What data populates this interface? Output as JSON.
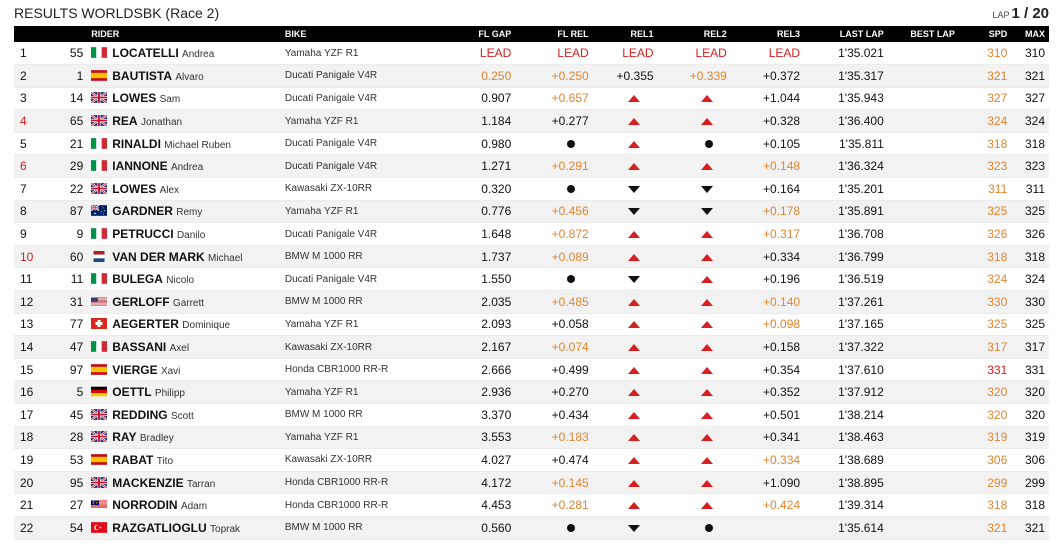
{
  "header": {
    "title": "RESULTS WORLDSBK (Race 2)",
    "lap_label": "LAP",
    "lap_value": "1 / 20"
  },
  "columns": [
    "RIDER",
    "BIKE",
    "FL GAP",
    "FL REL",
    "REL1",
    "REL2",
    "REL3",
    "LAST LAP",
    "BEST LAP",
    "SPD",
    "MAX"
  ],
  "colors": {
    "red": "#d42020",
    "orange": "#e0852e",
    "header_bg": "#000000"
  },
  "rows": [
    {
      "pos": "1",
      "num": "55",
      "flag": "italy-flag",
      "surname": "LOCATELLI",
      "given": "Andrea",
      "bike": "Yamaha YZF R1",
      "fl_gap": "LEAD",
      "fl_gap_c": "lead",
      "fl_rel": "LEAD",
      "fl_rel_c": "lead",
      "rel1": "LEAD",
      "rel1_c": "lead",
      "rel2": "LEAD",
      "rel2_c": "lead",
      "rel3": "LEAD",
      "rel3_c": "lead",
      "last_lap": "1'35.021",
      "best_lap": "",
      "spd": "310",
      "spd_c": "orange",
      "max": "310",
      "pos_red": false
    },
    {
      "pos": "2",
      "num": "1",
      "flag": "spain-flag",
      "surname": "BAUTISTA",
      "given": "Alvaro",
      "bike": "Ducati Panigale V4R",
      "fl_gap": "0.250",
      "fl_gap_c": "orange",
      "fl_rel": "+0.250",
      "fl_rel_c": "orange",
      "rel1": "+0.355",
      "rel1_c": "",
      "rel2": "+0.339",
      "rel2_c": "orange",
      "rel3": "+0.372",
      "rel3_c": "",
      "last_lap": "1'35.317",
      "best_lap": "",
      "spd": "321",
      "spd_c": "orange",
      "max": "321",
      "pos_red": false
    },
    {
      "pos": "3",
      "num": "14",
      "flag": "uk-flag",
      "surname": "LOWES",
      "given": "Sam",
      "bike": "Ducati Panigale V4R",
      "fl_gap": "0.907",
      "fl_gap_c": "",
      "fl_rel": "+0.657",
      "fl_rel_c": "orange",
      "rel1": "up",
      "rel1_c": "",
      "rel2": "up",
      "rel2_c": "",
      "rel3": "+1.044",
      "rel3_c": "",
      "last_lap": "1'35.943",
      "best_lap": "",
      "spd": "327",
      "spd_c": "orange",
      "max": "327",
      "pos_red": false
    },
    {
      "pos": "4",
      "num": "65",
      "flag": "uk-flag",
      "surname": "REA",
      "given": "Jonathan",
      "bike": "Yamaha YZF R1",
      "fl_gap": "1.184",
      "fl_gap_c": "",
      "fl_rel": "+0.277",
      "fl_rel_c": "",
      "rel1": "up",
      "rel1_c": "",
      "rel2": "up",
      "rel2_c": "",
      "rel3": "+0.328",
      "rel3_c": "",
      "last_lap": "1'36.400",
      "best_lap": "",
      "spd": "324",
      "spd_c": "orange",
      "max": "324",
      "pos_red": true
    },
    {
      "pos": "5",
      "num": "21",
      "flag": "italy-flag",
      "surname": "RINALDI",
      "given": "Michael Ruben",
      "bike": "Ducati Panigale V4R",
      "fl_gap": "0.980",
      "fl_gap_c": "",
      "fl_rel": "dot",
      "fl_rel_c": "",
      "rel1": "up",
      "rel1_c": "",
      "rel2": "dot",
      "rel2_c": "",
      "rel3": "+0.105",
      "rel3_c": "",
      "last_lap": "1'35.811",
      "best_lap": "",
      "spd": "318",
      "spd_c": "orange",
      "max": "318",
      "pos_red": false
    },
    {
      "pos": "6",
      "num": "29",
      "flag": "italy-flag",
      "surname": "IANNONE",
      "given": "Andrea",
      "bike": "Ducati Panigale V4R",
      "fl_gap": "1.271",
      "fl_gap_c": "",
      "fl_rel": "+0.291",
      "fl_rel_c": "orange",
      "rel1": "up",
      "rel1_c": "",
      "rel2": "up",
      "rel2_c": "",
      "rel3": "+0.148",
      "rel3_c": "orange",
      "last_lap": "1'36.324",
      "best_lap": "",
      "spd": "323",
      "spd_c": "orange",
      "max": "323",
      "pos_red": true
    },
    {
      "pos": "7",
      "num": "22",
      "flag": "uk-flag",
      "surname": "LOWES",
      "given": "Alex",
      "bike": "Kawasaki ZX-10RR",
      "fl_gap": "0.320",
      "fl_gap_c": "",
      "fl_rel": "dot",
      "fl_rel_c": "",
      "rel1": "down",
      "rel1_c": "",
      "rel2": "down",
      "rel2_c": "",
      "rel3": "+0.164",
      "rel3_c": "",
      "last_lap": "1'35.201",
      "best_lap": "",
      "spd": "311",
      "spd_c": "orange",
      "max": "311",
      "pos_red": false
    },
    {
      "pos": "8",
      "num": "87",
      "flag": "australia-flag",
      "surname": "GARDNER",
      "given": "Remy",
      "bike": "Yamaha YZF R1",
      "fl_gap": "0.776",
      "fl_gap_c": "",
      "fl_rel": "+0.456",
      "fl_rel_c": "orange",
      "rel1": "down",
      "rel1_c": "",
      "rel2": "down",
      "rel2_c": "",
      "rel3": "+0.178",
      "rel3_c": "orange",
      "last_lap": "1'35.891",
      "best_lap": "",
      "spd": "325",
      "spd_c": "orange",
      "max": "325",
      "pos_red": false
    },
    {
      "pos": "9",
      "num": "9",
      "flag": "italy-flag",
      "surname": "PETRUCCI",
      "given": "Danilo",
      "bike": "Ducati Panigale V4R",
      "fl_gap": "1.648",
      "fl_gap_c": "",
      "fl_rel": "+0.872",
      "fl_rel_c": "orange",
      "rel1": "up",
      "rel1_c": "",
      "rel2": "up",
      "rel2_c": "",
      "rel3": "+0.317",
      "rel3_c": "orange",
      "last_lap": "1'36.708",
      "best_lap": "",
      "spd": "326",
      "spd_c": "orange",
      "max": "326",
      "pos_red": false
    },
    {
      "pos": "10",
      "num": "60",
      "flag": "netherlands-flag",
      "surname": "VAN DER MARK",
      "given": "Michael",
      "bike": "BMW M 1000 RR",
      "fl_gap": "1.737",
      "fl_gap_c": "",
      "fl_rel": "+0.089",
      "fl_rel_c": "orange",
      "rel1": "up",
      "rel1_c": "",
      "rel2": "up",
      "rel2_c": "",
      "rel3": "+0.334",
      "rel3_c": "",
      "last_lap": "1'36.799",
      "best_lap": "",
      "spd": "318",
      "spd_c": "orange",
      "max": "318",
      "pos_red": true
    },
    {
      "pos": "11",
      "num": "11",
      "flag": "italy-flag",
      "surname": "BULEGA",
      "given": "Nicolo",
      "bike": "Ducati Panigale V4R",
      "fl_gap": "1.550",
      "fl_gap_c": "",
      "fl_rel": "dot",
      "fl_rel_c": "",
      "rel1": "down",
      "rel1_c": "",
      "rel2": "up",
      "rel2_c": "",
      "rel3": "+0.196",
      "rel3_c": "",
      "last_lap": "1'36.519",
      "best_lap": "",
      "spd": "324",
      "spd_c": "orange",
      "max": "324",
      "pos_red": false
    },
    {
      "pos": "12",
      "num": "31",
      "flag": "usa-flag",
      "surname": "GERLOFF",
      "given": "Garrett",
      "bike": "BMW M 1000 RR",
      "fl_gap": "2.035",
      "fl_gap_c": "",
      "fl_rel": "+0.485",
      "fl_rel_c": "orange",
      "rel1": "up",
      "rel1_c": "",
      "rel2": "up",
      "rel2_c": "",
      "rel3": "+0.140",
      "rel3_c": "orange",
      "last_lap": "1'37.261",
      "best_lap": "",
      "spd": "330",
      "spd_c": "orange",
      "max": "330",
      "pos_red": false
    },
    {
      "pos": "13",
      "num": "77",
      "flag": "switzerland-flag",
      "surname": "AEGERTER",
      "given": "Dominique",
      "bike": "Yamaha YZF R1",
      "fl_gap": "2.093",
      "fl_gap_c": "",
      "fl_rel": "+0.058",
      "fl_rel_c": "",
      "rel1": "up",
      "rel1_c": "",
      "rel2": "up",
      "rel2_c": "",
      "rel3": "+0.098",
      "rel3_c": "orange",
      "last_lap": "1'37.165",
      "best_lap": "",
      "spd": "325",
      "spd_c": "orange",
      "max": "325",
      "pos_red": false
    },
    {
      "pos": "14",
      "num": "47",
      "flag": "italy-flag",
      "surname": "BASSANI",
      "given": "Axel",
      "bike": "Kawasaki ZX-10RR",
      "fl_gap": "2.167",
      "fl_gap_c": "",
      "fl_rel": "+0.074",
      "fl_rel_c": "orange",
      "rel1": "up",
      "rel1_c": "",
      "rel2": "up",
      "rel2_c": "",
      "rel3": "+0.158",
      "rel3_c": "",
      "last_lap": "1'37.322",
      "best_lap": "",
      "spd": "317",
      "spd_c": "orange",
      "max": "317",
      "pos_red": false
    },
    {
      "pos": "15",
      "num": "97",
      "flag": "spain-flag",
      "surname": "VIERGE",
      "given": "Xavi",
      "bike": "Honda CBR1000 RR-R",
      "fl_gap": "2.666",
      "fl_gap_c": "",
      "fl_rel": "+0.499",
      "fl_rel_c": "",
      "rel1": "up",
      "rel1_c": "",
      "rel2": "up",
      "rel2_c": "",
      "rel3": "+0.354",
      "rel3_c": "",
      "last_lap": "1'37.610",
      "best_lap": "",
      "spd": "331",
      "spd_c": "red",
      "max": "331",
      "pos_red": false
    },
    {
      "pos": "16",
      "num": "5",
      "flag": "germany-flag",
      "surname": "OETTL",
      "given": "Philipp",
      "bike": "Yamaha YZF R1",
      "fl_gap": "2.936",
      "fl_gap_c": "",
      "fl_rel": "+0.270",
      "fl_rel_c": "",
      "rel1": "up",
      "rel1_c": "",
      "rel2": "up",
      "rel2_c": "",
      "rel3": "+0.352",
      "rel3_c": "",
      "last_lap": "1'37.912",
      "best_lap": "",
      "spd": "320",
      "spd_c": "orange",
      "max": "320",
      "pos_red": false
    },
    {
      "pos": "17",
      "num": "45",
      "flag": "uk-flag",
      "surname": "REDDING",
      "given": "Scott",
      "bike": "BMW M 1000 RR",
      "fl_gap": "3.370",
      "fl_gap_c": "",
      "fl_rel": "+0.434",
      "fl_rel_c": "",
      "rel1": "up",
      "rel1_c": "",
      "rel2": "up",
      "rel2_c": "",
      "rel3": "+0.501",
      "rel3_c": "",
      "last_lap": "1'38.214",
      "best_lap": "",
      "spd": "320",
      "spd_c": "orange",
      "max": "320",
      "pos_red": false
    },
    {
      "pos": "18",
      "num": "28",
      "flag": "uk-flag",
      "surname": "RAY",
      "given": "Bradley",
      "bike": "Yamaha YZF R1",
      "fl_gap": "3.553",
      "fl_gap_c": "",
      "fl_rel": "+0.183",
      "fl_rel_c": "orange",
      "rel1": "up",
      "rel1_c": "",
      "rel2": "up",
      "rel2_c": "",
      "rel3": "+0.341",
      "rel3_c": "",
      "last_lap": "1'38.463",
      "best_lap": "",
      "spd": "319",
      "spd_c": "orange",
      "max": "319",
      "pos_red": false
    },
    {
      "pos": "19",
      "num": "53",
      "flag": "spain-flag",
      "surname": "RABAT",
      "given": "Tito",
      "bike": "Kawasaki ZX-10RR",
      "fl_gap": "4.027",
      "fl_gap_c": "",
      "fl_rel": "+0.474",
      "fl_rel_c": "",
      "rel1": "up",
      "rel1_c": "",
      "rel2": "up",
      "rel2_c": "",
      "rel3": "+0.334",
      "rel3_c": "orange",
      "last_lap": "1'38.689",
      "best_lap": "",
      "spd": "306",
      "spd_c": "orange",
      "max": "306",
      "pos_red": false
    },
    {
      "pos": "20",
      "num": "95",
      "flag": "uk-flag",
      "surname": "MACKENZIE",
      "given": "Tarran",
      "bike": "Honda CBR1000 RR-R",
      "fl_gap": "4.172",
      "fl_gap_c": "",
      "fl_rel": "+0.145",
      "fl_rel_c": "orange",
      "rel1": "up",
      "rel1_c": "",
      "rel2": "up",
      "rel2_c": "",
      "rel3": "+1.090",
      "rel3_c": "",
      "last_lap": "1'38.895",
      "best_lap": "",
      "spd": "299",
      "spd_c": "orange",
      "max": "299",
      "pos_red": false
    },
    {
      "pos": "21",
      "num": "27",
      "flag": "malaysia-flag",
      "surname": "NORRODIN",
      "given": "Adam",
      "bike": "Honda CBR1000 RR-R",
      "fl_gap": "4.453",
      "fl_gap_c": "",
      "fl_rel": "+0.281",
      "fl_rel_c": "orange",
      "rel1": "up",
      "rel1_c": "",
      "rel2": "up",
      "rel2_c": "",
      "rel3": "+0.424",
      "rel3_c": "orange",
      "last_lap": "1'39.314",
      "best_lap": "",
      "spd": "318",
      "spd_c": "orange",
      "max": "318",
      "pos_red": false
    },
    {
      "pos": "22",
      "num": "54",
      "flag": "turkey-flag",
      "surname": "RAZGATLIOGLU",
      "given": "Toprak",
      "bike": "BMW M 1000 RR",
      "fl_gap": "0.560",
      "fl_gap_c": "",
      "fl_rel": "dot",
      "fl_rel_c": "",
      "rel1": "down",
      "rel1_c": "",
      "rel2": "dot",
      "rel2_c": "",
      "rel3": "",
      "rel3_c": "",
      "last_lap": "1'35.614",
      "best_lap": "",
      "spd": "321",
      "spd_c": "orange",
      "max": "321",
      "pos_red": false
    }
  ]
}
